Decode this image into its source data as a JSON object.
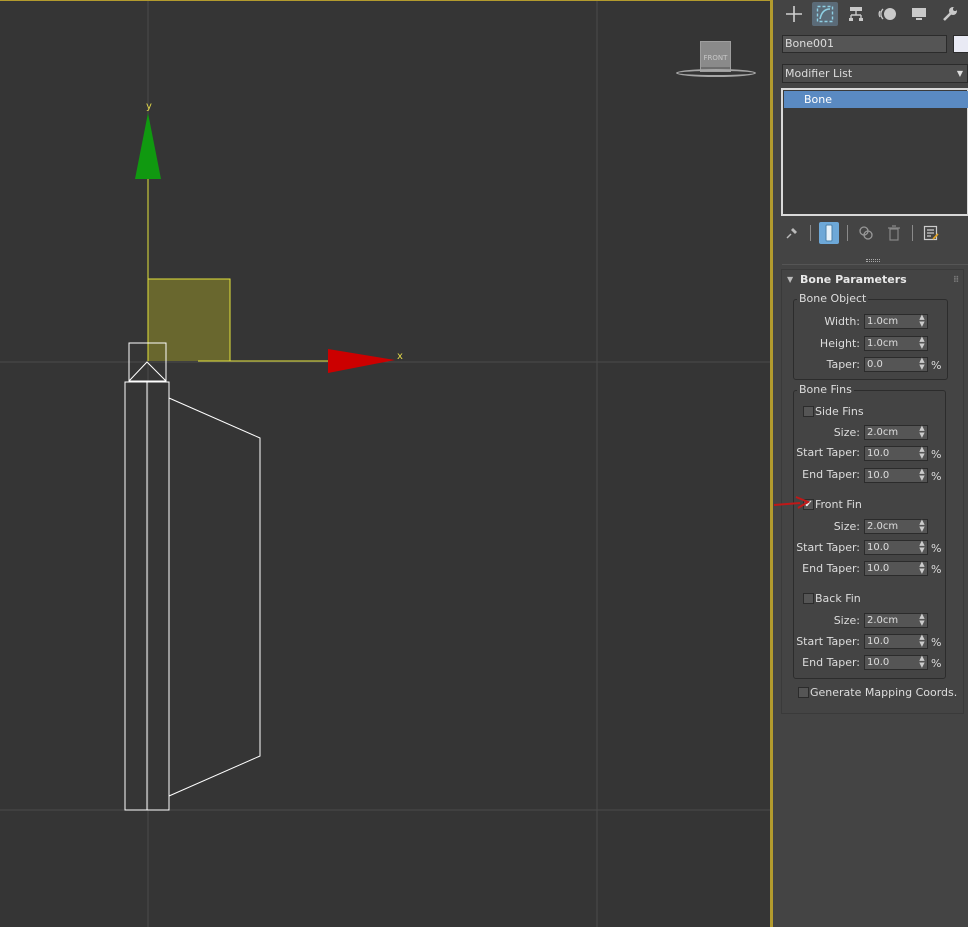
{
  "viewport": {
    "gizmo_y_label": "y",
    "gizmo_x_label": "x",
    "viewcube_label": "FRONT",
    "colors": {
      "border": "#b39b2e",
      "x_axis": "#cc0000",
      "y_axis": "#109910",
      "plane": "#6d6a2e",
      "wire": "#ffffff"
    }
  },
  "panel": {
    "tabs": [
      {
        "name": "create",
        "icon": "plus-icon"
      },
      {
        "name": "modify",
        "icon": "modify-curve-icon",
        "active": true
      },
      {
        "name": "hierarchy",
        "icon": "hierarchy-icon"
      },
      {
        "name": "motion",
        "icon": "motion-icon"
      },
      {
        "name": "display",
        "icon": "display-monitor-icon"
      },
      {
        "name": "utilities",
        "icon": "wrench-icon"
      }
    ],
    "object_name": "Bone001",
    "object_color": "#e9eaf4",
    "modifier_list": "Modifier List",
    "stack_items": [
      "Bone"
    ],
    "rollout_title": "Bone Parameters",
    "bone_object": {
      "title": "Bone Object",
      "width_label": "Width:",
      "width_value": "1.0cm",
      "height_label": "Height:",
      "height_value": "1.0cm",
      "taper_label": "Taper:",
      "taper_value": "0.0",
      "taper_unit": "%"
    },
    "bone_fins": {
      "title": "Bone Fins",
      "side": {
        "label": "Side Fins",
        "checked": false,
        "size_label": "Size:",
        "size_value": "2.0cm",
        "start_label": "Start Taper:",
        "start_value": "10.0",
        "end_label": "End Taper:",
        "end_value": "10.0",
        "unit": "%"
      },
      "front": {
        "label": "Front Fin",
        "checked": true,
        "check_glyph": "✔",
        "size_label": "Size:",
        "size_value": "2.0cm",
        "start_label": "Start Taper:",
        "start_value": "10.0",
        "end_label": "End Taper:",
        "end_value": "10.0",
        "unit": "%"
      },
      "back": {
        "label": "Back Fin",
        "checked": false,
        "size_label": "Size:",
        "size_value": "2.0cm",
        "start_label": "Start Taper:",
        "start_value": "10.0",
        "end_label": "End Taper:",
        "end_value": "10.0",
        "unit": "%"
      }
    },
    "generate_mapping": {
      "label": "Generate Mapping Coords.",
      "checked": false
    }
  }
}
